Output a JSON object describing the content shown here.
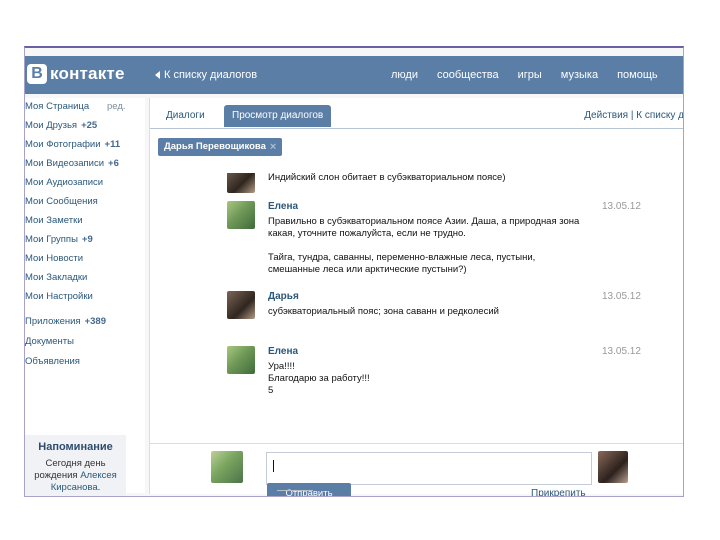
{
  "top": {
    "logo_letter": "В",
    "logo_text": "контакте",
    "back_to_dialogs": "К списку диалогов",
    "nav": [
      "люди",
      "сообщества",
      "игры",
      "музыка",
      "помощь"
    ]
  },
  "sidebar": {
    "edit": "ред.",
    "items": [
      {
        "label": "Моя Страница",
        "count": ""
      },
      {
        "label": "Мои Друзья",
        "count": "+25"
      },
      {
        "label": "Мои Фотографии",
        "count": "+11"
      },
      {
        "label": "Мои Видеозаписи",
        "count": "+6"
      },
      {
        "label": "Мои Аудиозаписи",
        "count": ""
      },
      {
        "label": "Мои Сообщения",
        "count": ""
      },
      {
        "label": "Мои Заметки",
        "count": ""
      },
      {
        "label": "Мои Группы",
        "count": "+9"
      },
      {
        "label": "Мои Новости",
        "count": ""
      },
      {
        "label": "Мои Закладки",
        "count": ""
      },
      {
        "label": "Мои Настройки",
        "count": ""
      },
      {
        "label": "Приложения",
        "count": "+389"
      },
      {
        "label": "Документы",
        "count": ""
      },
      {
        "label": "Объявления",
        "count": ""
      }
    ],
    "reminder": {
      "title": "Напоминание",
      "text_prefix": "Сегодня день рождения",
      "name": "Алексея Кирсанова",
      "suffix": "."
    }
  },
  "tabs": {
    "dialogs": "Диалоги",
    "view": "Просмотр диалогов",
    "actions": "Действия",
    "separator": "|",
    "back": "К списку д"
  },
  "chip": {
    "name": "Дарья Перевощикова",
    "close": "×"
  },
  "messages": [
    {
      "author": "",
      "date": "",
      "text": "Индийский слон обитает в субэкваториальном поясе)"
    },
    {
      "author": "Елена",
      "date": "13.05.12",
      "text": "Правильно в субэкваториальном поясе Азии. Даша, а природная зона какая, уточните пожалуйста, если не трудно.",
      "text2": "Тайга, тундра, саванны, переменно-влажные леса, пустыни, смешанные леса или арктические пустыни?)"
    },
    {
      "author": "Дарья",
      "date": "13.05.12",
      "text": "субэкваториальный пояс; зона саванн и редколесий"
    },
    {
      "author": "Елена",
      "date": "13.05.12",
      "text": "Ура!!!!\nБлагодарю за работу!!!\n5"
    }
  ],
  "composer": {
    "send": "Отправить",
    "attach": "Прикрепить"
  }
}
